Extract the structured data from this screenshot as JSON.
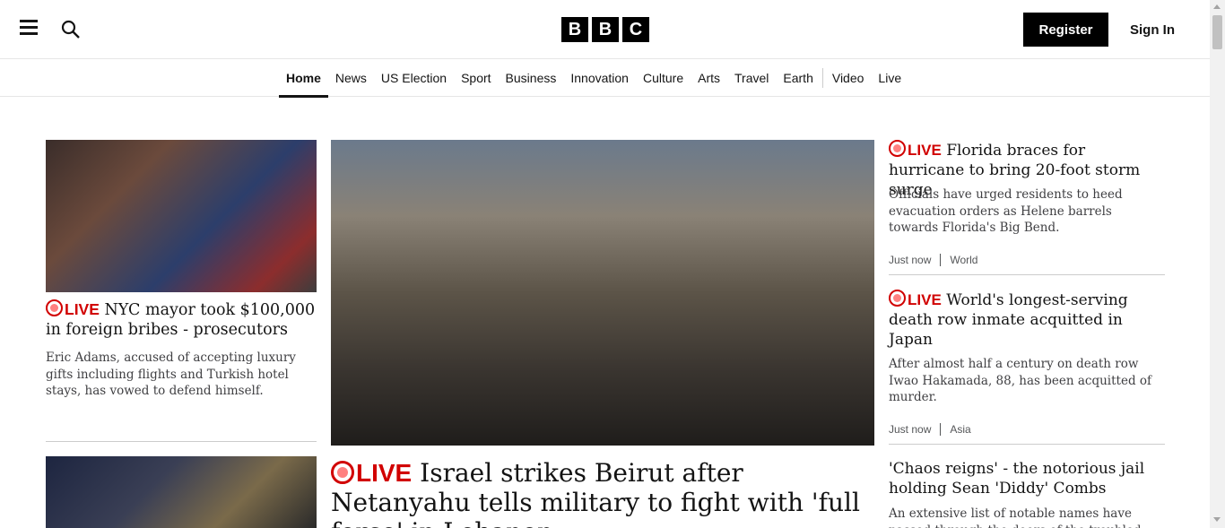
{
  "header": {
    "logo_letters": [
      "B",
      "B",
      "C"
    ],
    "register_label": "Register",
    "signin_label": "Sign In",
    "menu_icon": "hamburger-icon",
    "search_icon": "search-icon"
  },
  "nav": {
    "items": [
      {
        "label": "Home",
        "active": true
      },
      {
        "label": "News"
      },
      {
        "label": "US Election"
      },
      {
        "label": "Sport"
      },
      {
        "label": "Business"
      },
      {
        "label": "Innovation"
      },
      {
        "label": "Culture"
      },
      {
        "label": "Arts"
      },
      {
        "label": "Travel"
      },
      {
        "label": "Earth"
      },
      {
        "label": "Video"
      },
      {
        "label": "Live"
      }
    ]
  },
  "stories": {
    "nyc": {
      "live": "LIVE",
      "headline": "NYC mayor took $100,000 in foreign bribes - prosecutors",
      "summary": "Eric Adams, accused of accepting luxury gifts including flights and Turkish hotel stays, has vowed to defend himself."
    },
    "beirut": {
      "live": "LIVE",
      "headline": "Israel strikes Beirut after Netanyahu tells military to fight with 'full force' in Lebanon"
    },
    "florida": {
      "live": "LIVE",
      "headline": "Florida braces for hurricane to bring 20-foot storm surge",
      "summary": "Officials have urged residents to heed evacuation orders as Helene barrels towards Florida's Big Bend.",
      "time": "Just now",
      "section": "World"
    },
    "japan": {
      "live": "LIVE",
      "headline": "World's longest-serving death row inmate acquitted in Japan",
      "summary": "After almost half a century on death row Iwao Hakamada, 88, has been acquitted of murder.",
      "time": "Just now",
      "section": "Asia"
    },
    "diddy": {
      "headline": "'Chaos reigns' - the notorious jail holding Sean 'Diddy' Combs",
      "summary": "An extensive list of notable names have passed through the doors of the troubled"
    }
  },
  "colors": {
    "live_red": "#d10000",
    "text": "#141414"
  }
}
